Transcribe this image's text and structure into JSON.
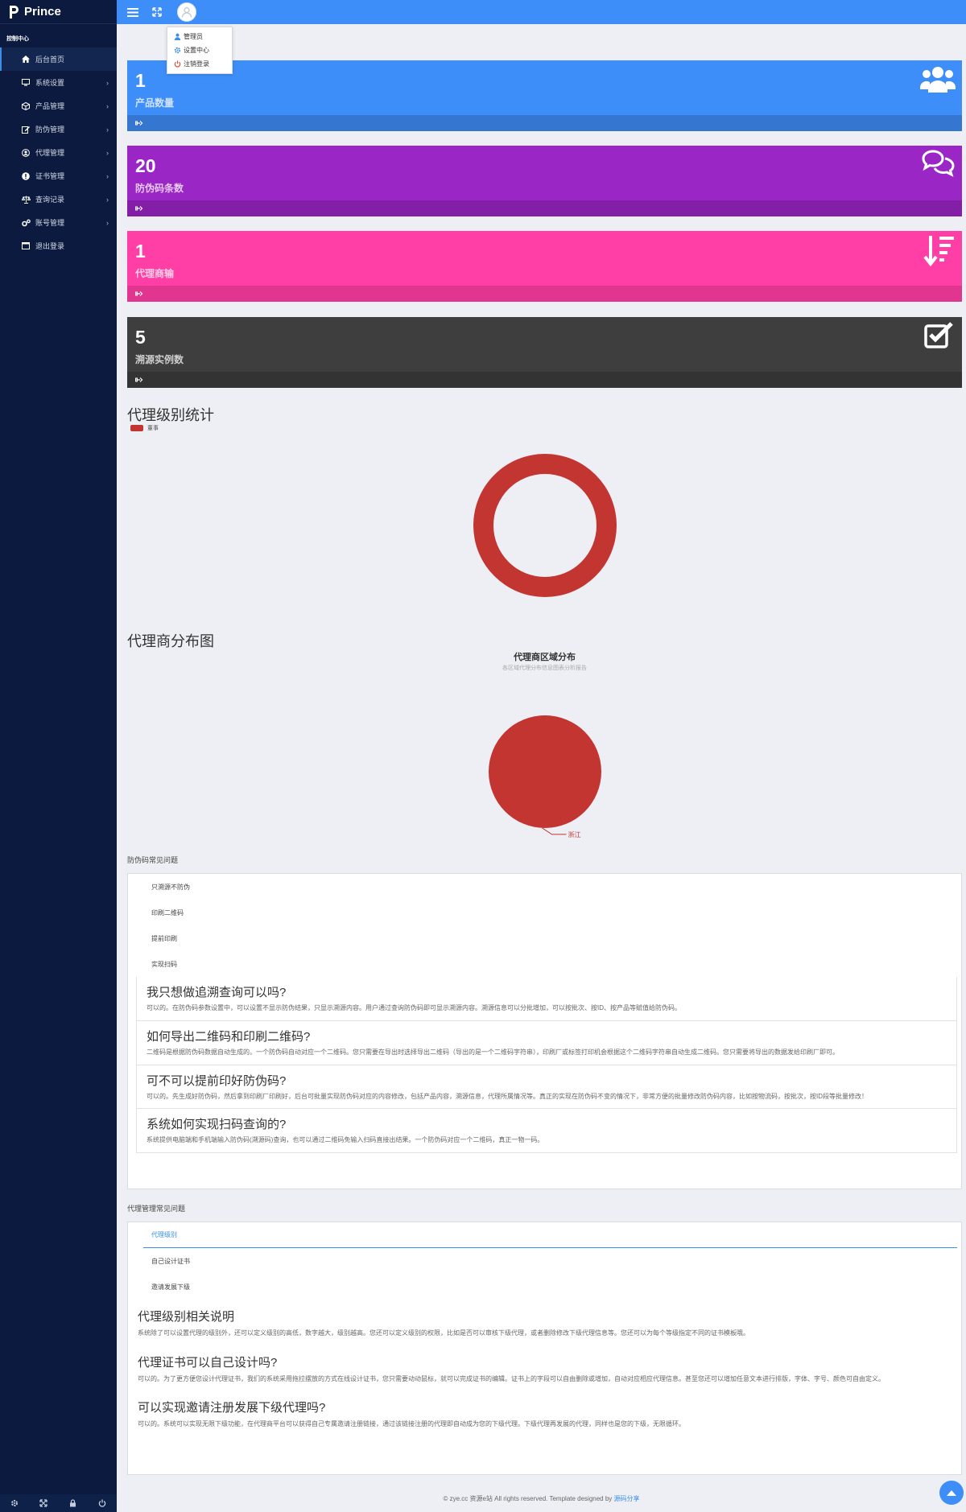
{
  "brand": {
    "name": "Prince"
  },
  "sidebar": {
    "heading": "控制中心",
    "items": [
      {
        "label": "后台首页",
        "icon": "home-icon",
        "active": true,
        "has_children": false
      },
      {
        "label": "系统设置",
        "icon": "monitor-icon",
        "active": false,
        "has_children": true
      },
      {
        "label": "产品管理",
        "icon": "cube-icon",
        "active": false,
        "has_children": true
      },
      {
        "label": "防伪管理",
        "icon": "edit-icon",
        "active": false,
        "has_children": true
      },
      {
        "label": "代理管理",
        "icon": "user-circle-icon",
        "active": false,
        "has_children": true
      },
      {
        "label": "证书管理",
        "icon": "info-icon",
        "active": false,
        "has_children": true
      },
      {
        "label": "查询记录",
        "icon": "balance-scale-icon",
        "active": false,
        "has_children": true
      },
      {
        "label": "账号管理",
        "icon": "cogs-icon",
        "active": false,
        "has_children": true
      },
      {
        "label": "退出登录",
        "icon": "window-icon",
        "active": false,
        "has_children": false
      }
    ],
    "footer_icons": [
      "gear-icon",
      "expand-icon",
      "lock-icon",
      "power-icon"
    ]
  },
  "user_menu": {
    "items": [
      {
        "label": "管理员",
        "icon": "user-icon",
        "color": "#3a8ee6"
      },
      {
        "label": "设置中心",
        "icon": "gear-icon",
        "color": "#3a8ee6"
      },
      {
        "label": "注销登录",
        "icon": "power-icon",
        "color": "#e74c3c"
      }
    ]
  },
  "stats": [
    {
      "value": "1",
      "label": "产品数量",
      "color": "#3d8ef8",
      "icon": "users-icon"
    },
    {
      "value": "20",
      "label": "防伪码条数",
      "color": "#9b26c6",
      "icon": "comments-icon"
    },
    {
      "value": "1",
      "label": "代理商输",
      "color": "#ff3fa6",
      "icon": "sort-amount-icon"
    },
    {
      "value": "5",
      "label": "溯源实例数",
      "color": "#3e3e3e",
      "icon": "check-square-icon"
    }
  ],
  "level_section": {
    "title": "代理级别统计"
  },
  "dist_section": {
    "title": "代理商分布图"
  },
  "chart_data": [
    {
      "type": "pie",
      "variant": "donut",
      "title": "",
      "legend": [
        "董事"
      ],
      "legend_position": "top-left",
      "slices": [
        {
          "name": "董事",
          "value": 1,
          "color": "#c23531"
        }
      ]
    },
    {
      "type": "pie",
      "title": "代理商区域分布",
      "subtitle": "各区域代理分布信息图表分析报告",
      "slices": [
        {
          "name": "浙江",
          "value": 1,
          "color": "#c23531"
        }
      ]
    }
  ],
  "anti_fake_faq": {
    "title": "防伪码常见问题",
    "tabs": [
      "只溯源不防伪",
      "印刷二维码",
      "提前印刷",
      "实现扫码"
    ],
    "items": [
      {
        "q": "我只想做追溯查询可以吗?",
        "a": "可以的。在防伪码参数设置中，可以设置不显示防伪结果，只显示溯源内容。用户通过查询防伪码即可显示溯源内容。溯源信息可以分批增加，可以按批次、按ID、按产品等赋值给防伪码。"
      },
      {
        "q": "如何导出二维码和印刷二维码?",
        "a": "二维码是根据防伪码数据自动生成的。一个防伪码自动对应一个二维码。您只需要在导出时选择导出二维码（导出的是一个二维码字符串），印刷厂或标签打印机会根据这个二维码字符串自动生成二维码。您只需要将导出的数据发给印刷厂即可。"
      },
      {
        "q": "可不可以提前印好防伪码?",
        "a": "可以的。先生成好防伪码，然后拿到印刷厂印刷好，后台可批量实现防伪码对应的内容修改，包括产品内容，溯源信息，代理所属情况等。真正的实现在防伪码不变的情况下，非常方便的批量修改防伪码内容，比如按物流码，按批次，按ID段等批量修改！"
      },
      {
        "q": "系统如何实现扫码查询的?",
        "a": "系统提供电脑端和手机端输入防伪码(溯源码)查询，也可以通过二维码免输入扫码直接出结果。一个防伪码对应一个二维码，真正一物一码。"
      }
    ]
  },
  "agent_faq": {
    "title": "代理管理常见问题",
    "tabs": [
      "代理级别",
      "自己设计证书",
      "邀请发展下级"
    ],
    "active_tab": 0,
    "items": [
      {
        "q": "代理级别相关说明",
        "a": "系统除了可以设置代理的级别外，还可以定义级别的高低，数字越大，级别越高。您还可以定义级别的权限，比如是否可以审核下级代理，或者删除修改下级代理信息等。您还可以为每个等级指定不同的证书模板哦。"
      },
      {
        "q": "代理证书可以自己设计吗?",
        "a": "可以的。为了更方便您设计代理证书，我们的系统采用拖拉摆放的方式在线设计证书，您只需要动动鼠标，就可以完成证书的编辑。证书上的字段可以自由删除或增加，自动对应相应代理信息。甚至您还可以增加任意文本进行排版，字体、字号、颜色可自由定义。"
      },
      {
        "q": "可以实现邀请注册发展下级代理吗?",
        "a": "可以的。系统可以实现无限下级功能，在代理商平台可以获得自己专属邀请注册链接，通过该链接注册的代理即自动成为您的下级代理。下级代理再发展的代理，同样也是您的下级，无限循环。"
      }
    ]
  },
  "footer": {
    "text": "© zye.cc 资源e站 All rights reserved. Template designed by ",
    "link": "源码分享"
  }
}
